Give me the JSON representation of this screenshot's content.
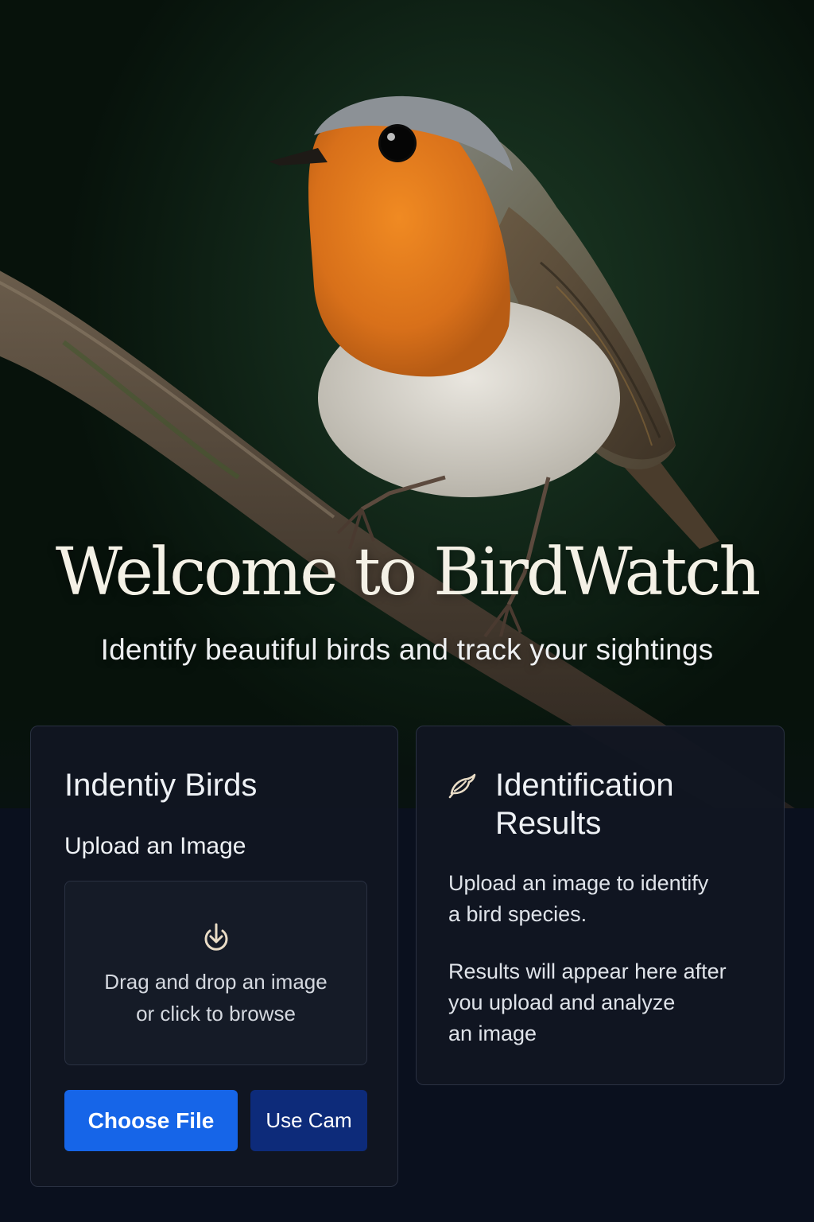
{
  "hero": {
    "title": "Welcome to BirdWatch",
    "subtitle": "Identify beautiful birds and track your sightings"
  },
  "identify_card": {
    "title": "Indentiy Birds",
    "upload_label": "Upload an Image",
    "dropzone": {
      "icon": "download-icon",
      "line1": "Drag and drop an image",
      "line2": "or click to browse"
    },
    "choose_file_label": "Choose File",
    "use_cam_label": "Use Cam"
  },
  "results_card": {
    "icon": "bird-icon",
    "title_line1": "Identification",
    "title_line2": "Results",
    "text1_line1": "Upload an image to identify",
    "text1_line2": "a bird species.",
    "text2_line1": "Results will appear here after",
    "text2_line2": "you upload and analyze",
    "text2_line3": "an image"
  },
  "colors": {
    "primary_button": "#1665e8",
    "secondary_button": "#0d2b7a",
    "card_background": "#111621",
    "page_background": "#0a101e",
    "robin_orange": "#e07a1a"
  }
}
